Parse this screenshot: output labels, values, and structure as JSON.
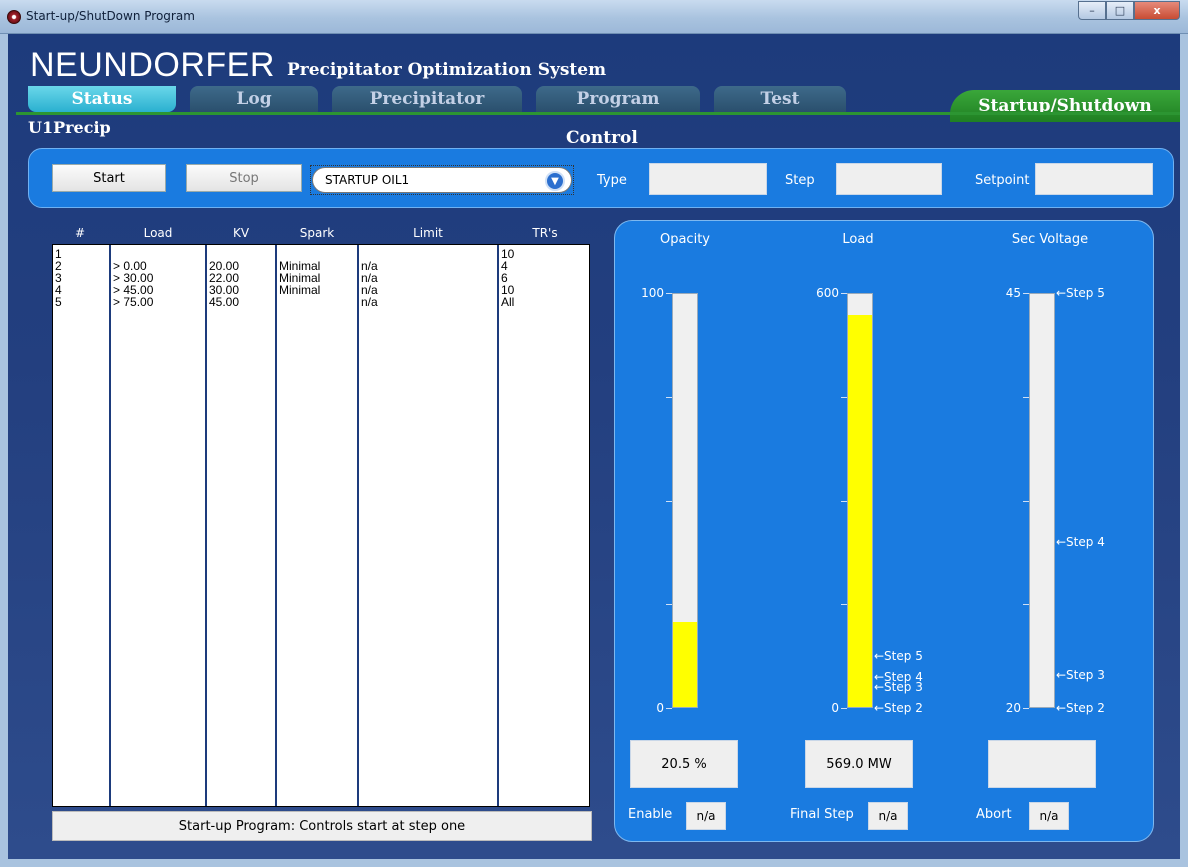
{
  "window": {
    "title": "Start-up/ShutDown Program",
    "min": "–",
    "max": "□",
    "close": "x"
  },
  "header": {
    "brand": "NEUNDORFER",
    "subtitle": "Precipitator Optimization System"
  },
  "tabs": [
    {
      "label": "Status",
      "active": true
    },
    {
      "label": "Log",
      "active": false
    },
    {
      "label": "Precipitator",
      "active": false
    },
    {
      "label": "Program",
      "active": false
    },
    {
      "label": "Test",
      "active": false
    }
  ],
  "startup_tab": "Startup/Shutdown",
  "unit_name": "U1Precip",
  "control": {
    "title": "Control",
    "start_label": "Start",
    "stop_label": "Stop",
    "program_selected": "STARTUP OIL1",
    "type_label": "Type",
    "type_value": "",
    "step_label": "Step",
    "step_value": "",
    "setpoint_label": "Setpoint",
    "setpoint_value": ""
  },
  "table": {
    "columns": [
      "#",
      "Load",
      "KV",
      "Spark",
      "Limit",
      "TR's"
    ],
    "rows": [
      [
        "1",
        "",
        "",
        "",
        "",
        "10"
      ],
      [
        "2",
        "> 0.00",
        "20.00",
        "Minimal",
        "n/a",
        "4"
      ],
      [
        "3",
        "> 30.00",
        "22.00",
        "Minimal",
        "n/a",
        "6"
      ],
      [
        "4",
        "> 45.00",
        "30.00",
        "Minimal",
        "n/a",
        "10"
      ],
      [
        "5",
        "> 75.00",
        "45.00",
        "",
        "n/a",
        "All"
      ]
    ],
    "status_message": "Start-up Program: Controls start at step one"
  },
  "gauges": {
    "opacity": {
      "title": "Opacity",
      "min": 0,
      "max": 100,
      "min_label": "0",
      "max_label": "100",
      "value": 20.5,
      "readout": "20.5 %",
      "markers": []
    },
    "load": {
      "title": "Load",
      "min": 0,
      "max": 600,
      "min_label": "0",
      "max_label": "600",
      "value": 569.0,
      "readout": "569.0 MW",
      "markers": [
        {
          "label": "Step 5",
          "value": 75
        },
        {
          "label": "Step 4",
          "value": 45
        },
        {
          "label": "Step 3",
          "value": 30
        },
        {
          "label": "Step 2",
          "value": 0
        }
      ]
    },
    "sec_voltage": {
      "title": "Sec Voltage",
      "min": 20,
      "max": 45,
      "min_label": "20",
      "max_label": "45",
      "value": null,
      "readout": "",
      "markers": [
        {
          "label": "Step 5",
          "value": 45
        },
        {
          "label": "Step 4",
          "value": 30
        },
        {
          "label": "Step 3",
          "value": 22
        },
        {
          "label": "Step 2",
          "value": 20
        }
      ]
    }
  },
  "footer": {
    "enable_label": "Enable",
    "enable_value": "n/a",
    "final_step_label": "Final Step",
    "final_step_value": "n/a",
    "abort_label": "Abort",
    "abort_value": "n/a"
  },
  "colors": {
    "panel": "#1a7be0",
    "fill": "#ffff00",
    "accent_green": "#2c9532"
  }
}
